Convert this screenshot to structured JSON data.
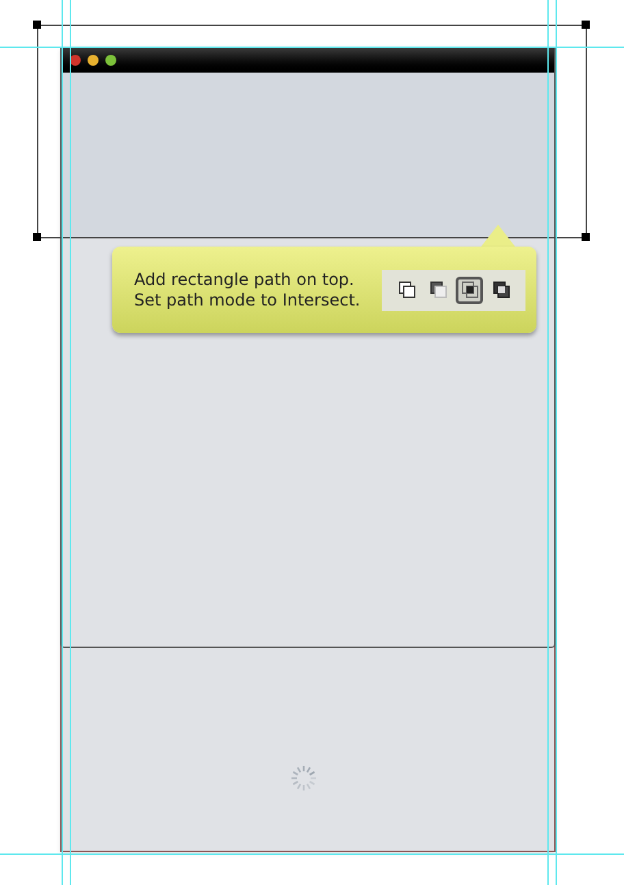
{
  "window_controls": [
    {
      "color": "#d0342c"
    },
    {
      "color": "#e8b12f"
    },
    {
      "color": "#7cc13a"
    }
  ],
  "callout": {
    "lines": [
      "Add rectangle path on top.",
      "Set path mode to Intersect."
    ],
    "path_modes": [
      {
        "kind": "combine",
        "selected": false
      },
      {
        "kind": "subtract",
        "selected": false
      },
      {
        "kind": "intersect",
        "selected": true
      },
      {
        "kind": "exclude",
        "selected": false
      }
    ]
  }
}
